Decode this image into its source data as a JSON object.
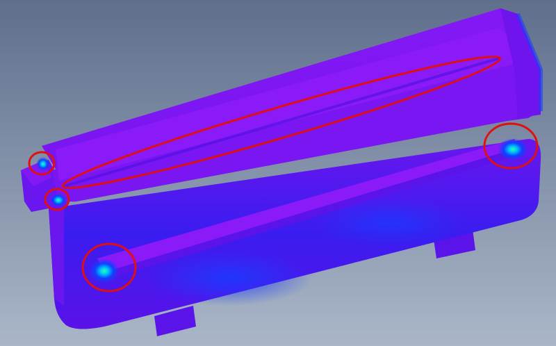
{
  "viewport": {
    "background_top": "#5f6f8c",
    "background_bottom": "#aab6c8"
  },
  "model": {
    "part_name": "stress-plot-tray-part",
    "colors": {
      "low_stress": "#7a16f2",
      "mid_stress": "#3a1cf0",
      "elevated_stress": "#1040ff",
      "high_stress": "#00c8ff",
      "peak_stress": "#30ff90",
      "edge_shadow": "#2a0aa8"
    }
  },
  "annotations": {
    "color": "#e01010",
    "markers": [
      {
        "name": "hotspot-top-left-corner"
      },
      {
        "name": "hotspot-left-lip"
      },
      {
        "name": "hotspot-bottom-left-rail"
      },
      {
        "name": "hotspot-right-rail-end"
      },
      {
        "name": "long-seam-ellipse"
      }
    ]
  }
}
